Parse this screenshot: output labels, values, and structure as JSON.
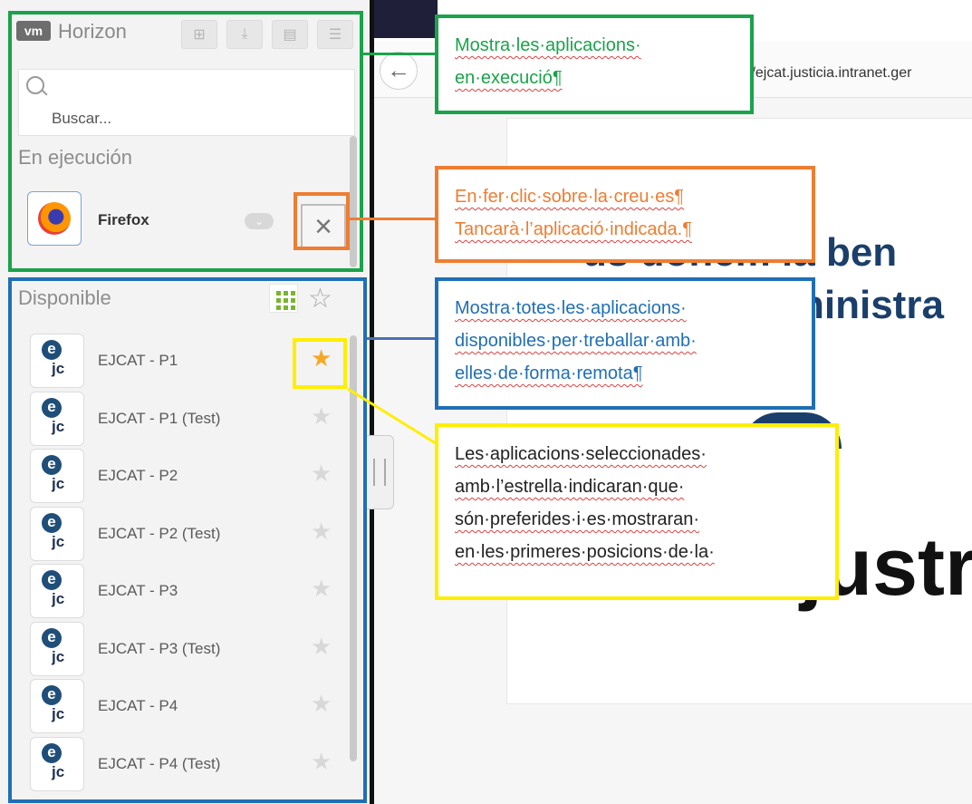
{
  "sidebar": {
    "logo": "vm",
    "title": "Horizon",
    "search": {
      "placeholder": "Buscar..."
    },
    "running": {
      "title": "En ejecución",
      "app": {
        "name": "Firefox",
        "chevron": "chevron-down-icon",
        "close": "×"
      }
    },
    "available": {
      "title": "Disponible",
      "apps": [
        {
          "name": "EJCAT - P1",
          "favorite": true
        },
        {
          "name": "EJCAT - P1 (Test)",
          "favorite": false
        },
        {
          "name": "EJCAT - P2",
          "favorite": false
        },
        {
          "name": "EJCAT - P2 (Test)",
          "favorite": false
        },
        {
          "name": "EJCAT - P3",
          "favorite": false
        },
        {
          "name": "EJCAT - P3 (Test)",
          "favorite": false
        },
        {
          "name": "EJCAT - P4",
          "favorite": false
        },
        {
          "name": "EJCAT - P4 (Test)",
          "favorite": false
        }
      ],
      "icon_text": {
        "e": "e",
        "jc": "jc"
      }
    }
  },
  "browser": {
    "url": "s:/ejcat.justicia.intranet.ger",
    "hero_line1": "us donem la ben",
    "hero_line2": "ninistra",
    "hero_big": "justr"
  },
  "callouts": {
    "green": {
      "lines": [
        "Mostra·les·aplicacions·",
        "en·execució¶"
      ],
      "color": "#1aa34a"
    },
    "orange": {
      "lines": [
        "En·fer·clic·sobre·la·creu·es¶",
        "Tancarà·l’aplicació·indicada.¶"
      ],
      "color": "#ee7d31"
    },
    "blue": {
      "lines": [
        "Mostra·totes·les·aplicacions·",
        "disponibles·per·treballar·amb·",
        "elles·de·forma·remota¶"
      ],
      "color": "#1f6fb5"
    },
    "yellow": {
      "lines": [
        "Les·aplicacions·seleccionades·",
        "amb·l’estrella·indicaran·que·",
        "són·preferides·i·es·mostraran·",
        "en·les·primeres·posicions·de·la·"
      ],
      "color": "#222222"
    }
  },
  "colors": {
    "green": "#1aa34a",
    "orange": "#ee7d31",
    "blue": "#1f6fb5",
    "yellow": "#ffee00",
    "star_active": "#f4a825"
  }
}
